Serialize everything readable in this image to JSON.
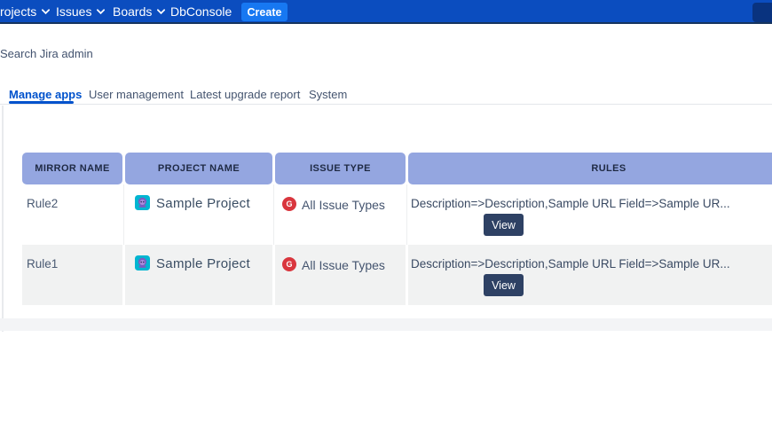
{
  "navbar": {
    "items": [
      {
        "label": "rojects",
        "has_dropdown": true
      },
      {
        "label": "Issues",
        "has_dropdown": true
      },
      {
        "label": "Boards",
        "has_dropdown": true
      },
      {
        "label": "DbConsole",
        "has_dropdown": false
      }
    ],
    "create_label": "Create",
    "colors": {
      "bg": "#0B4DBF",
      "create_button": "#1778F2",
      "search_stub": "#09337F"
    }
  },
  "admin": {
    "search_label": "Search Jira admin"
  },
  "tabs": [
    {
      "label": "Manage apps",
      "active": true
    },
    {
      "label": "User management",
      "active": false
    },
    {
      "label": "Latest upgrade report",
      "active": false
    },
    {
      "label": "System",
      "active": false
    }
  ],
  "table": {
    "headers": [
      "MIRROR NAME",
      "PROJECT NAME",
      "ISSUE TYPE",
      "RULES"
    ],
    "rows": [
      {
        "mirror_name": "Rule2",
        "project_name": "Sample Project",
        "issue_type": "All Issue Types",
        "rules": "Description=>Description,Sample URL Field=>Sample UR...",
        "view_label": "View"
      },
      {
        "mirror_name": "Rule1",
        "project_name": "Sample Project",
        "issue_type": "All Issue Types",
        "rules": "Description=>Description,Sample URL Field=>Sample UR...",
        "view_label": "View"
      }
    ]
  },
  "icons": {
    "issue_type_glyph": "G",
    "project_avatar": "project-avatar-icon",
    "nav_chevron": "chevron-down-icon"
  },
  "colors": {
    "tab_active": "#0052CC",
    "table_header_bg": "#94A6E0",
    "row_alt_bg": "#F1F2F2",
    "view_button_bg": "#2E4164",
    "issue_icon_bg": "#D9363E",
    "project_avatar_bg": "#00B5D1"
  }
}
